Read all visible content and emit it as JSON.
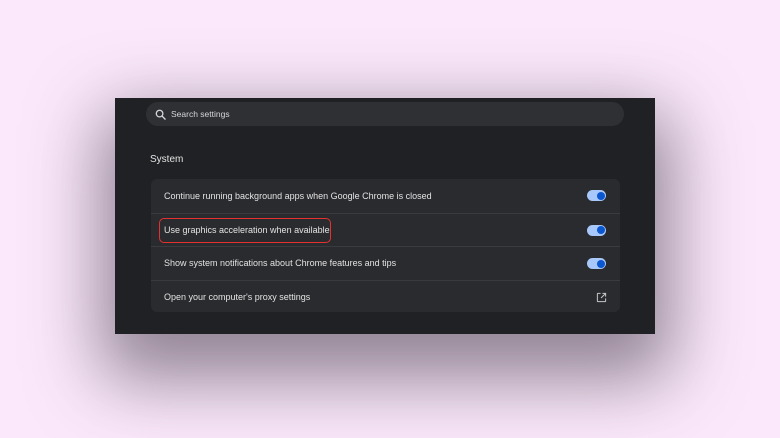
{
  "search": {
    "placeholder": "Search settings"
  },
  "section": {
    "title": "System"
  },
  "rows": [
    {
      "label": "Continue running background apps when Google Chrome is closed",
      "control": "toggle",
      "enabled": true
    },
    {
      "label": "Use graphics acceleration when available",
      "control": "toggle",
      "enabled": true,
      "highlighted": true
    },
    {
      "label": "Show system notifications about Chrome features and tips",
      "control": "toggle",
      "enabled": true
    },
    {
      "label": "Open your computer's proxy settings",
      "control": "external-link-icon"
    }
  ],
  "colors": {
    "page_background": "#fbe9fb",
    "window_background": "#202124",
    "card_background": "#2a2b2e",
    "toggle_track": "#a8c7fa",
    "toggle_knob": "#0b57d0",
    "highlight_border": "#e3312f"
  }
}
